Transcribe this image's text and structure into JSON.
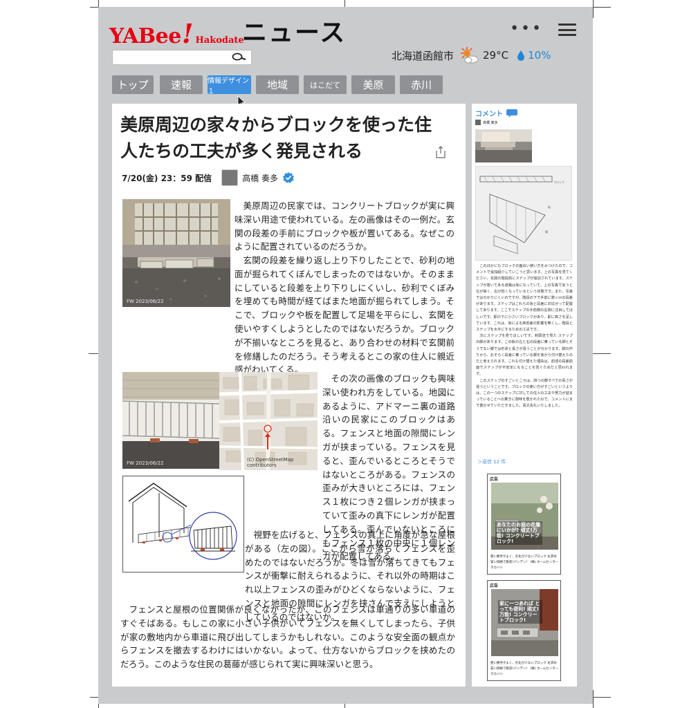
{
  "header": {
    "logo_main": "YABee",
    "logo_excl": "!",
    "logo_sub": "Hakodate",
    "logo_news": "ニュース",
    "more_icon": "more-dots-icon",
    "menu_icon": "hamburger-menu-icon",
    "search_icon": "search-icon"
  },
  "weather": {
    "location": "北海道函館市",
    "icon": "sun-cloud-icon",
    "temperature": "29°C",
    "rain_icon": "water-drop-icon",
    "rain_chance": "10%"
  },
  "tabs": [
    {
      "label": "トップ"
    },
    {
      "label": "速報"
    },
    {
      "label": "情報デザイン１",
      "active": true
    },
    {
      "label": "地域"
    },
    {
      "label": "はこだて"
    },
    {
      "label": "美原"
    },
    {
      "label": "赤川"
    }
  ],
  "article": {
    "title": "美原周辺の家々からブロックを使った住人たちの工夫が多く発見される",
    "date": "7/20(金) 23：59 配信",
    "author": "高橋 奏多",
    "photo1_label": "FW 2023/06/22",
    "photo2_label": "FW 2023/06/22",
    "map_label": "(C) OpenStreetMap contributors",
    "para1_a": "美原周辺の民家では、コンクリートブロックが実に興味深い用途で使われている。左の画像はその一例だ。玄関の段差の手前にブロックや板が置いてある。なぜこのように配置されているのだろうか。",
    "para1_b": "玄関の段差を繰り返し上り下りしたことで、砂利の地面が掘られてくぼんでしまったのではないか。そのままにしていると段差を上り下りしにくいし、砂利でくぼみを埋めても時間が経てばまた地面が掘られてしまう。そこで、ブロックや板を配置して足場を平らにし、玄関を使いやすくしようとしたのではないだろうか。ブロックが不揃いなところを見ると、あり合わせの材料で玄関前を修繕したのだろう。そう考えるとこの家の住人に親近感がわいてくる。",
    "para2": "その次の画像のブロックも興味深い使われ方をしている。地図にあるように、アドマーニ裏の道路沿いの民家にこのブロックはある。フェンスと地面の隙間にレンガが挟まっている。フェンスを見ると、歪んでいるところとそうではないところがある。フェンスの歪みが大きいところには、フェンス１枚につき２個レンガが挟まっていて歪みの真下にレンガが配置してある。歪んでいないところにもフェンス１枚の中央に１個レンガが配置してある。",
    "para3": "視野を広げると、フェンスの真上に角度が急な屋根がある（左の図）。ここから雪が落ちてフェンスを歪めたのではないだろうか。冬は雪が落ちてきてもフェンスが衝撃に耐えられるように、それ以外の時期はこれ以上フェンスの歪みがひどくならないように、フェンスと地面の隙間にレンガを挟さんで支えにしようとしているのではないか。",
    "para4": "フェンスと屋根の位置関係が良くなかったが、このフェンスは車通りの多い車道のすぐそばある。もしこの家に小さい子供がいてフェンスを無くしてしまったら、子供が家の敷地内から車道に飛び出してしまうかもしれない。このような安全面の観点からフェンスを撤去するわけにはいかない。よって、仕方ないからブロックを挟めたのだろう。このような住民の葛藤が感じられて実に興味深いと思う。"
  },
  "sidebar": {
    "comment_title": "コメント",
    "commenter": "高橋 奏多",
    "comment_p1": "このほかにもブロックの面白い使い方をみつけたので、コメントで追加紹介していこうと思います。上の写真を見てください。玄関の階段前にステップが追加されています。ステップが置いてある道路は坂になっていて、上の写真で言うと左が高く、右が低くなっているという状態です。また、写真では分かりにくいのですが、階段の下で手前に数ｃｍの段差があります。ステップはこれらの坂と段差に対応がって配置してあります。ここでステップの手前側の右側に注目してほしいです。即の下に小さいブロックがあり、即に高さを足しています。これは、坂による高低差の影響を無くし、階段とステップを水平にするための工夫です。",
    "comment_p2": "次にステップを見てほしいです。到頭流で見た ステップの脚があります。この板の左と右の段差に乗っている脚とそうでない脚では形状と長さが違うことが分かります。脚の作りから、おそらく段差に乗っている脚を後から付け替えたのだと考えられます。これも付け替えた理由は、前述の段差前面でステップが不安定になることを防ぐためだと思われます。",
    "comment_p3": "このステップのすごいところは、四つの脚すべての長さが違うということです。ブロックの使い方がすごいというよりは、この一つのステップに対しての住人の工夫や努力が詰まっていることへの驚きに興味を惹かれたので、コメントにまで書かせていただきました。長文失礼いたしました。",
    "reply_link": "＞返信 12 件"
  },
  "ads": [
    {
      "label": "広告",
      "overlay": "あなたのお庭の花壇にいかが? 頑丈!万能! コンクリートブロック!",
      "desc": "使い勝手がよく、劣化が少ないブロック お求め安い価格で販売!パンデン！ (株) ホームセンター タカハシ"
    },
    {
      "label": "広告",
      "overlay": "家に一つあれば とっても便利! 頑丈!万能! コンクリートブロック!",
      "desc": "使い勝手がよく、劣化が少ないブロック お求め安い価格で販売!パンデン！ (株) ホームセンター タカハシ"
    }
  ],
  "colors": {
    "logo_red": "#e60012",
    "tab_gray": "#8f9195",
    "tab_active": "#3f8fe0",
    "page_bg": "#cacbcc",
    "rain_blue": "#1e88d6"
  }
}
